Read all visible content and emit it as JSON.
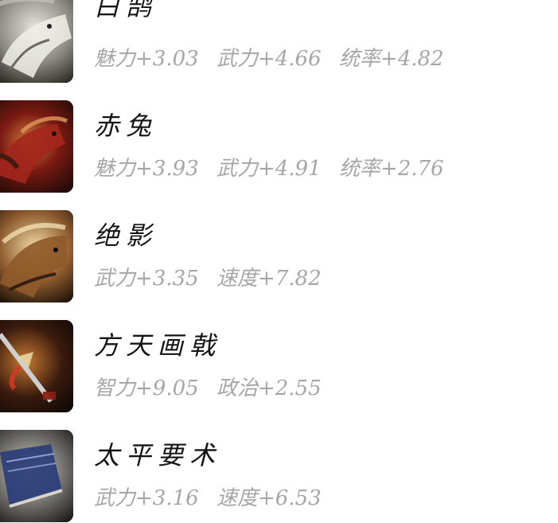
{
  "items": [
    {
      "name": "白鹄",
      "stats": [
        "魅力+3.03",
        "武力+4.66",
        "统率+4.82"
      ],
      "icon": "white-horse-icon"
    },
    {
      "name": "赤兔",
      "stats": [
        "魅力+3.93",
        "武力+4.91",
        "统率+2.76"
      ],
      "icon": "red-horse-icon"
    },
    {
      "name": "绝影",
      "stats": [
        "武力+3.35",
        "速度+7.82"
      ],
      "icon": "brown-horse-icon"
    },
    {
      "name": "方天画戟",
      "stats": [
        "智力+9.05",
        "政治+2.55"
      ],
      "icon": "halberd-icon"
    },
    {
      "name": "太平要术",
      "stats": [
        "武力+3.16",
        "速度+6.53"
      ],
      "icon": "book-icon"
    }
  ]
}
